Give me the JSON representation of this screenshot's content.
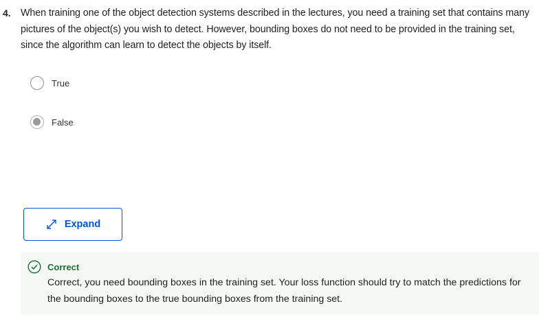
{
  "question": {
    "number": "4.",
    "text": "When training one of the object detection systems described in the lectures, you need a training set that contains many pictures of the object(s) you wish to detect. However, bounding boxes do not need to be provided in the training set, since the algorithm can learn to detect the objects by itself."
  },
  "options": [
    {
      "label": "True",
      "selected": false
    },
    {
      "label": "False",
      "selected": true
    }
  ],
  "expand_button": {
    "label": "Expand",
    "icon": "expand-arrows-icon"
  },
  "feedback": {
    "status": "Correct",
    "icon": "check-circle-icon",
    "text": "Correct, you need bounding boxes in the training set. Your loss function should try to match the predictions for the bounding boxes to the true bounding boxes from the training set."
  },
  "colors": {
    "accent": "#0056d2",
    "success": "#1e6b34",
    "feedback_bg": "#f4f9f5"
  }
}
